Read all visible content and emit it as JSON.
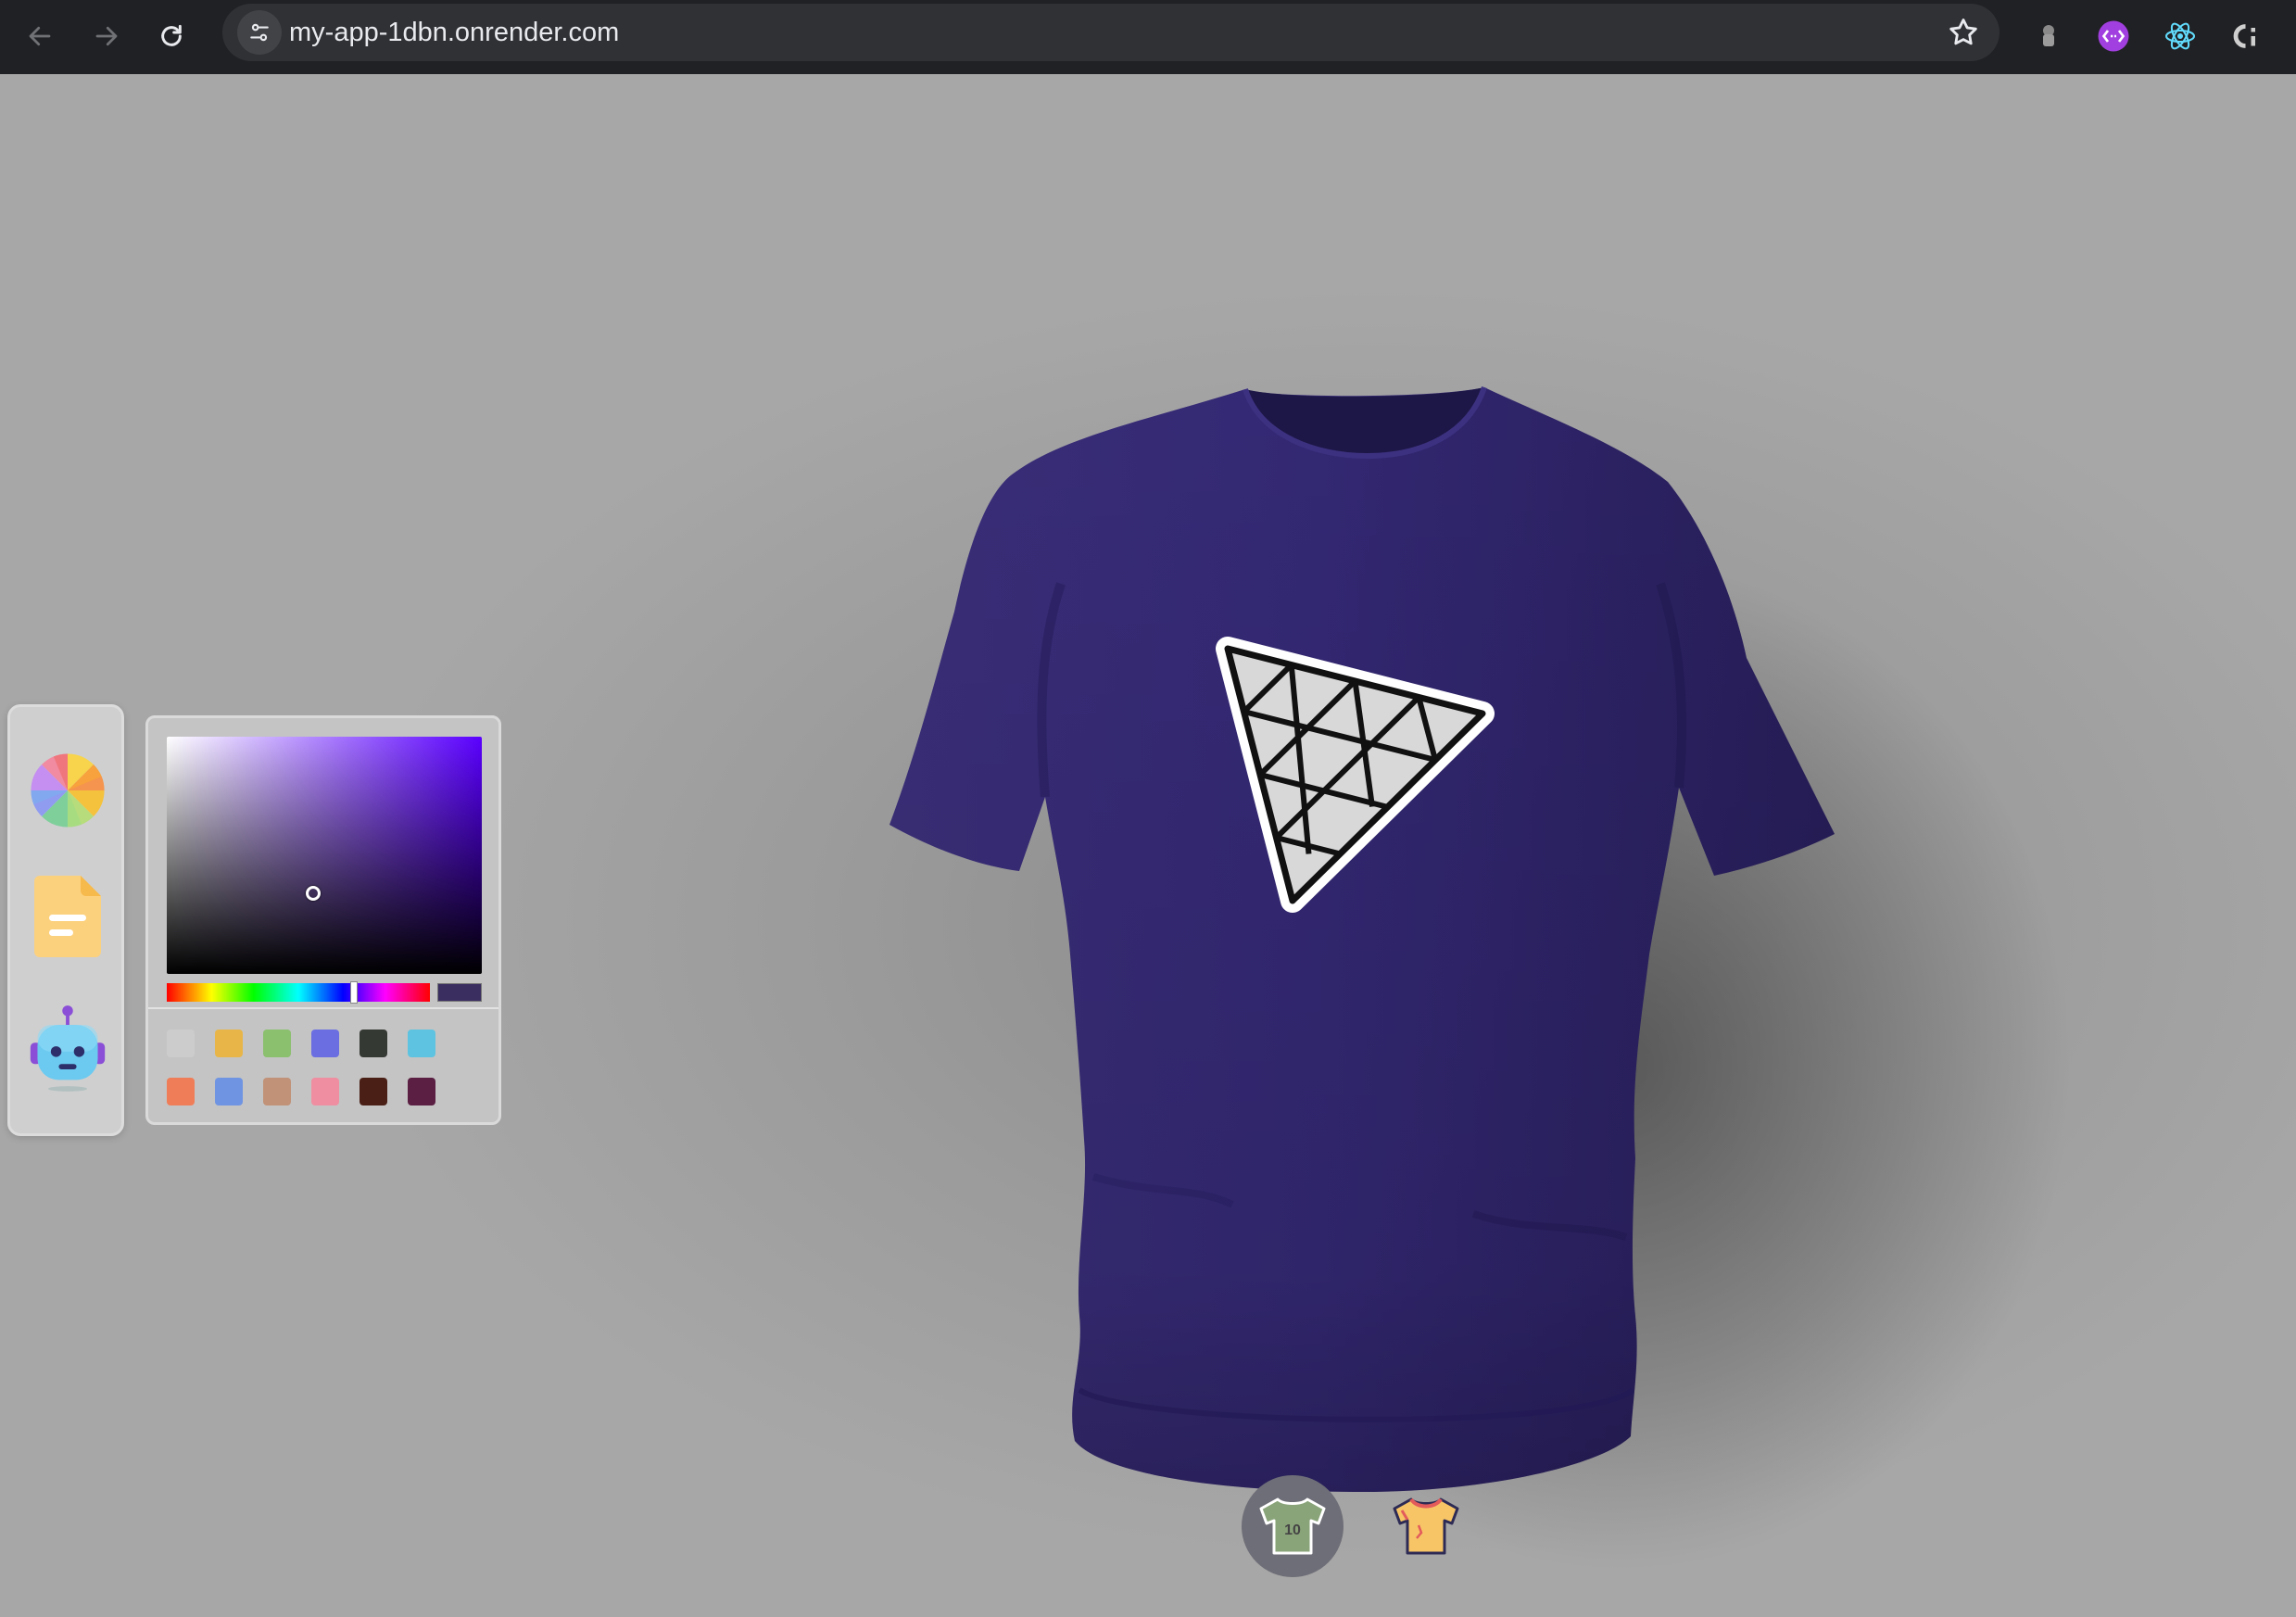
{
  "browser": {
    "url": "my-app-1dbn.onrender.com"
  },
  "colors": {
    "shirt": "#2f2566",
    "shirt_highlight": "#3a2e78",
    "shirt_shadow": "#1d1747",
    "selected_color": "#3a2e60",
    "accent": "#5a00ff"
  },
  "toolbar": {
    "tools": [
      {
        "name": "color-picker-tool",
        "icon": "color-wheel-icon"
      },
      {
        "name": "file-picker-tool",
        "icon": "document-icon"
      },
      {
        "name": "ai-picker-tool",
        "icon": "robot-icon"
      }
    ]
  },
  "color_picker": {
    "swatches": [
      "#cccccc",
      "#e8b648",
      "#8bc06e",
      "#6b6ee0",
      "#353934",
      "#5ec3e0",
      "#ef7d57",
      "#6f94e2",
      "#c19277",
      "#ef8ea1",
      "#4a1f16",
      "#5a1f42"
    ]
  },
  "bottom_tabs": [
    {
      "name": "logo-shirt-tab",
      "icon": "logo-shirt-icon",
      "active": true,
      "text": "10"
    },
    {
      "name": "stylish-shirt-tab",
      "icon": "stylish-shirt-icon",
      "active": false
    }
  ]
}
